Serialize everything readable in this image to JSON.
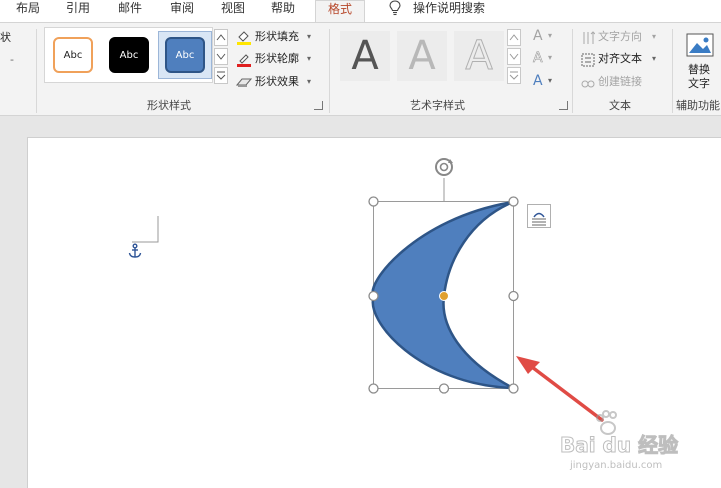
{
  "tabs": [
    {
      "label": "布局"
    },
    {
      "label": "引用"
    },
    {
      "label": "邮件"
    },
    {
      "label": "审阅"
    },
    {
      "label": "视图"
    },
    {
      "label": "帮助"
    },
    {
      "label": "格式"
    },
    {
      "label": "操作说明搜索"
    }
  ],
  "left_cut": {
    "label1": "状",
    "label2": "-"
  },
  "shape_styles": {
    "group_label": "形状样式",
    "presets": [
      {
        "label": "Abc"
      },
      {
        "label": "Abc"
      },
      {
        "label": "Abc"
      }
    ],
    "fill_label": "形状填充",
    "outline_label": "形状轮廓",
    "effects_label": "形状效果"
  },
  "wordart": {
    "group_label": "艺术字样式",
    "presets": [
      {
        "label": "A"
      },
      {
        "label": "A"
      },
      {
        "label": "A"
      }
    ],
    "side": [
      "A",
      "A",
      "A"
    ]
  },
  "text_group": {
    "group_label": "文本",
    "direction_label": "文字方向",
    "align_label": "对齐文本",
    "link_label": "创建链接"
  },
  "accessibility": {
    "group_label": "辅助功能",
    "alt_text_line1": "替换",
    "alt_text_line2": "文字"
  },
  "watermark": {
    "brand": "Bai du 经验",
    "url": "jingyan.baidu.com"
  },
  "colors": {
    "accent": "#b7472a",
    "shape_fill": "#4f7fbe",
    "shape_outline": "#2e5587",
    "arrow": "#e04b45",
    "handle_center": "#e0a030"
  }
}
